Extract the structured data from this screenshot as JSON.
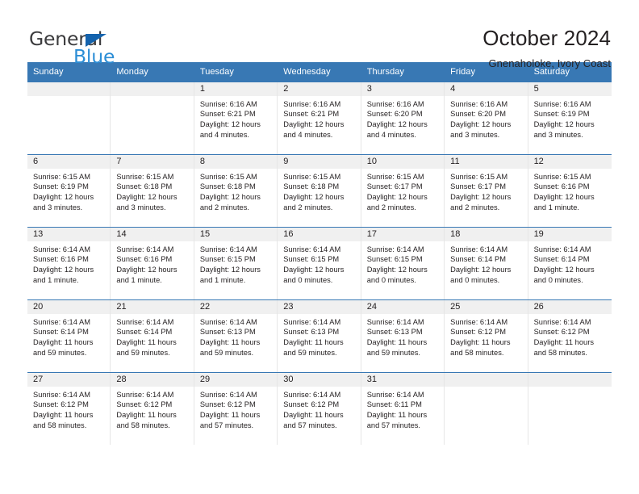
{
  "brand": {
    "name_top": "General",
    "name_bottom": "Blue",
    "triangle_color": "#1463ad",
    "blue_color": "#2c8ed6",
    "gray_color": "#3b3b3d"
  },
  "header": {
    "title": "October 2024",
    "subtitle": "Gnenaholoke, Ivory Coast"
  },
  "theme": {
    "header_blue": "#3878b4",
    "daynum_band": "#f0f0f0",
    "cell_border": "#e6e6e6",
    "text": "#231f20"
  },
  "weekdays": [
    "Sunday",
    "Monday",
    "Tuesday",
    "Wednesday",
    "Thursday",
    "Friday",
    "Saturday"
  ],
  "weeks": [
    [
      {
        "day": "",
        "sunrise": "",
        "sunset": "",
        "daylight1": "",
        "daylight2": ""
      },
      {
        "day": "",
        "sunrise": "",
        "sunset": "",
        "daylight1": "",
        "daylight2": ""
      },
      {
        "day": "1",
        "sunrise": "Sunrise: 6:16 AM",
        "sunset": "Sunset: 6:21 PM",
        "daylight1": "Daylight: 12 hours",
        "daylight2": "and 4 minutes."
      },
      {
        "day": "2",
        "sunrise": "Sunrise: 6:16 AM",
        "sunset": "Sunset: 6:21 PM",
        "daylight1": "Daylight: 12 hours",
        "daylight2": "and 4 minutes."
      },
      {
        "day": "3",
        "sunrise": "Sunrise: 6:16 AM",
        "sunset": "Sunset: 6:20 PM",
        "daylight1": "Daylight: 12 hours",
        "daylight2": "and 4 minutes."
      },
      {
        "day": "4",
        "sunrise": "Sunrise: 6:16 AM",
        "sunset": "Sunset: 6:20 PM",
        "daylight1": "Daylight: 12 hours",
        "daylight2": "and 3 minutes."
      },
      {
        "day": "5",
        "sunrise": "Sunrise: 6:16 AM",
        "sunset": "Sunset: 6:19 PM",
        "daylight1": "Daylight: 12 hours",
        "daylight2": "and 3 minutes."
      }
    ],
    [
      {
        "day": "6",
        "sunrise": "Sunrise: 6:15 AM",
        "sunset": "Sunset: 6:19 PM",
        "daylight1": "Daylight: 12 hours",
        "daylight2": "and 3 minutes."
      },
      {
        "day": "7",
        "sunrise": "Sunrise: 6:15 AM",
        "sunset": "Sunset: 6:18 PM",
        "daylight1": "Daylight: 12 hours",
        "daylight2": "and 3 minutes."
      },
      {
        "day": "8",
        "sunrise": "Sunrise: 6:15 AM",
        "sunset": "Sunset: 6:18 PM",
        "daylight1": "Daylight: 12 hours",
        "daylight2": "and 2 minutes."
      },
      {
        "day": "9",
        "sunrise": "Sunrise: 6:15 AM",
        "sunset": "Sunset: 6:18 PM",
        "daylight1": "Daylight: 12 hours",
        "daylight2": "and 2 minutes."
      },
      {
        "day": "10",
        "sunrise": "Sunrise: 6:15 AM",
        "sunset": "Sunset: 6:17 PM",
        "daylight1": "Daylight: 12 hours",
        "daylight2": "and 2 minutes."
      },
      {
        "day": "11",
        "sunrise": "Sunrise: 6:15 AM",
        "sunset": "Sunset: 6:17 PM",
        "daylight1": "Daylight: 12 hours",
        "daylight2": "and 2 minutes."
      },
      {
        "day": "12",
        "sunrise": "Sunrise: 6:15 AM",
        "sunset": "Sunset: 6:16 PM",
        "daylight1": "Daylight: 12 hours",
        "daylight2": "and 1 minute."
      }
    ],
    [
      {
        "day": "13",
        "sunrise": "Sunrise: 6:14 AM",
        "sunset": "Sunset: 6:16 PM",
        "daylight1": "Daylight: 12 hours",
        "daylight2": "and 1 minute."
      },
      {
        "day": "14",
        "sunrise": "Sunrise: 6:14 AM",
        "sunset": "Sunset: 6:16 PM",
        "daylight1": "Daylight: 12 hours",
        "daylight2": "and 1 minute."
      },
      {
        "day": "15",
        "sunrise": "Sunrise: 6:14 AM",
        "sunset": "Sunset: 6:15 PM",
        "daylight1": "Daylight: 12 hours",
        "daylight2": "and 1 minute."
      },
      {
        "day": "16",
        "sunrise": "Sunrise: 6:14 AM",
        "sunset": "Sunset: 6:15 PM",
        "daylight1": "Daylight: 12 hours",
        "daylight2": "and 0 minutes."
      },
      {
        "day": "17",
        "sunrise": "Sunrise: 6:14 AM",
        "sunset": "Sunset: 6:15 PM",
        "daylight1": "Daylight: 12 hours",
        "daylight2": "and 0 minutes."
      },
      {
        "day": "18",
        "sunrise": "Sunrise: 6:14 AM",
        "sunset": "Sunset: 6:14 PM",
        "daylight1": "Daylight: 12 hours",
        "daylight2": "and 0 minutes."
      },
      {
        "day": "19",
        "sunrise": "Sunrise: 6:14 AM",
        "sunset": "Sunset: 6:14 PM",
        "daylight1": "Daylight: 12 hours",
        "daylight2": "and 0 minutes."
      }
    ],
    [
      {
        "day": "20",
        "sunrise": "Sunrise: 6:14 AM",
        "sunset": "Sunset: 6:14 PM",
        "daylight1": "Daylight: 11 hours",
        "daylight2": "and 59 minutes."
      },
      {
        "day": "21",
        "sunrise": "Sunrise: 6:14 AM",
        "sunset": "Sunset: 6:14 PM",
        "daylight1": "Daylight: 11 hours",
        "daylight2": "and 59 minutes."
      },
      {
        "day": "22",
        "sunrise": "Sunrise: 6:14 AM",
        "sunset": "Sunset: 6:13 PM",
        "daylight1": "Daylight: 11 hours",
        "daylight2": "and 59 minutes."
      },
      {
        "day": "23",
        "sunrise": "Sunrise: 6:14 AM",
        "sunset": "Sunset: 6:13 PM",
        "daylight1": "Daylight: 11 hours",
        "daylight2": "and 59 minutes."
      },
      {
        "day": "24",
        "sunrise": "Sunrise: 6:14 AM",
        "sunset": "Sunset: 6:13 PM",
        "daylight1": "Daylight: 11 hours",
        "daylight2": "and 59 minutes."
      },
      {
        "day": "25",
        "sunrise": "Sunrise: 6:14 AM",
        "sunset": "Sunset: 6:12 PM",
        "daylight1": "Daylight: 11 hours",
        "daylight2": "and 58 minutes."
      },
      {
        "day": "26",
        "sunrise": "Sunrise: 6:14 AM",
        "sunset": "Sunset: 6:12 PM",
        "daylight1": "Daylight: 11 hours",
        "daylight2": "and 58 minutes."
      }
    ],
    [
      {
        "day": "27",
        "sunrise": "Sunrise: 6:14 AM",
        "sunset": "Sunset: 6:12 PM",
        "daylight1": "Daylight: 11 hours",
        "daylight2": "and 58 minutes."
      },
      {
        "day": "28",
        "sunrise": "Sunrise: 6:14 AM",
        "sunset": "Sunset: 6:12 PM",
        "daylight1": "Daylight: 11 hours",
        "daylight2": "and 58 minutes."
      },
      {
        "day": "29",
        "sunrise": "Sunrise: 6:14 AM",
        "sunset": "Sunset: 6:12 PM",
        "daylight1": "Daylight: 11 hours",
        "daylight2": "and 57 minutes."
      },
      {
        "day": "30",
        "sunrise": "Sunrise: 6:14 AM",
        "sunset": "Sunset: 6:12 PM",
        "daylight1": "Daylight: 11 hours",
        "daylight2": "and 57 minutes."
      },
      {
        "day": "31",
        "sunrise": "Sunrise: 6:14 AM",
        "sunset": "Sunset: 6:11 PM",
        "daylight1": "Daylight: 11 hours",
        "daylight2": "and 57 minutes."
      },
      {
        "day": "",
        "sunrise": "",
        "sunset": "",
        "daylight1": "",
        "daylight2": ""
      },
      {
        "day": "",
        "sunrise": "",
        "sunset": "",
        "daylight1": "",
        "daylight2": ""
      }
    ]
  ]
}
